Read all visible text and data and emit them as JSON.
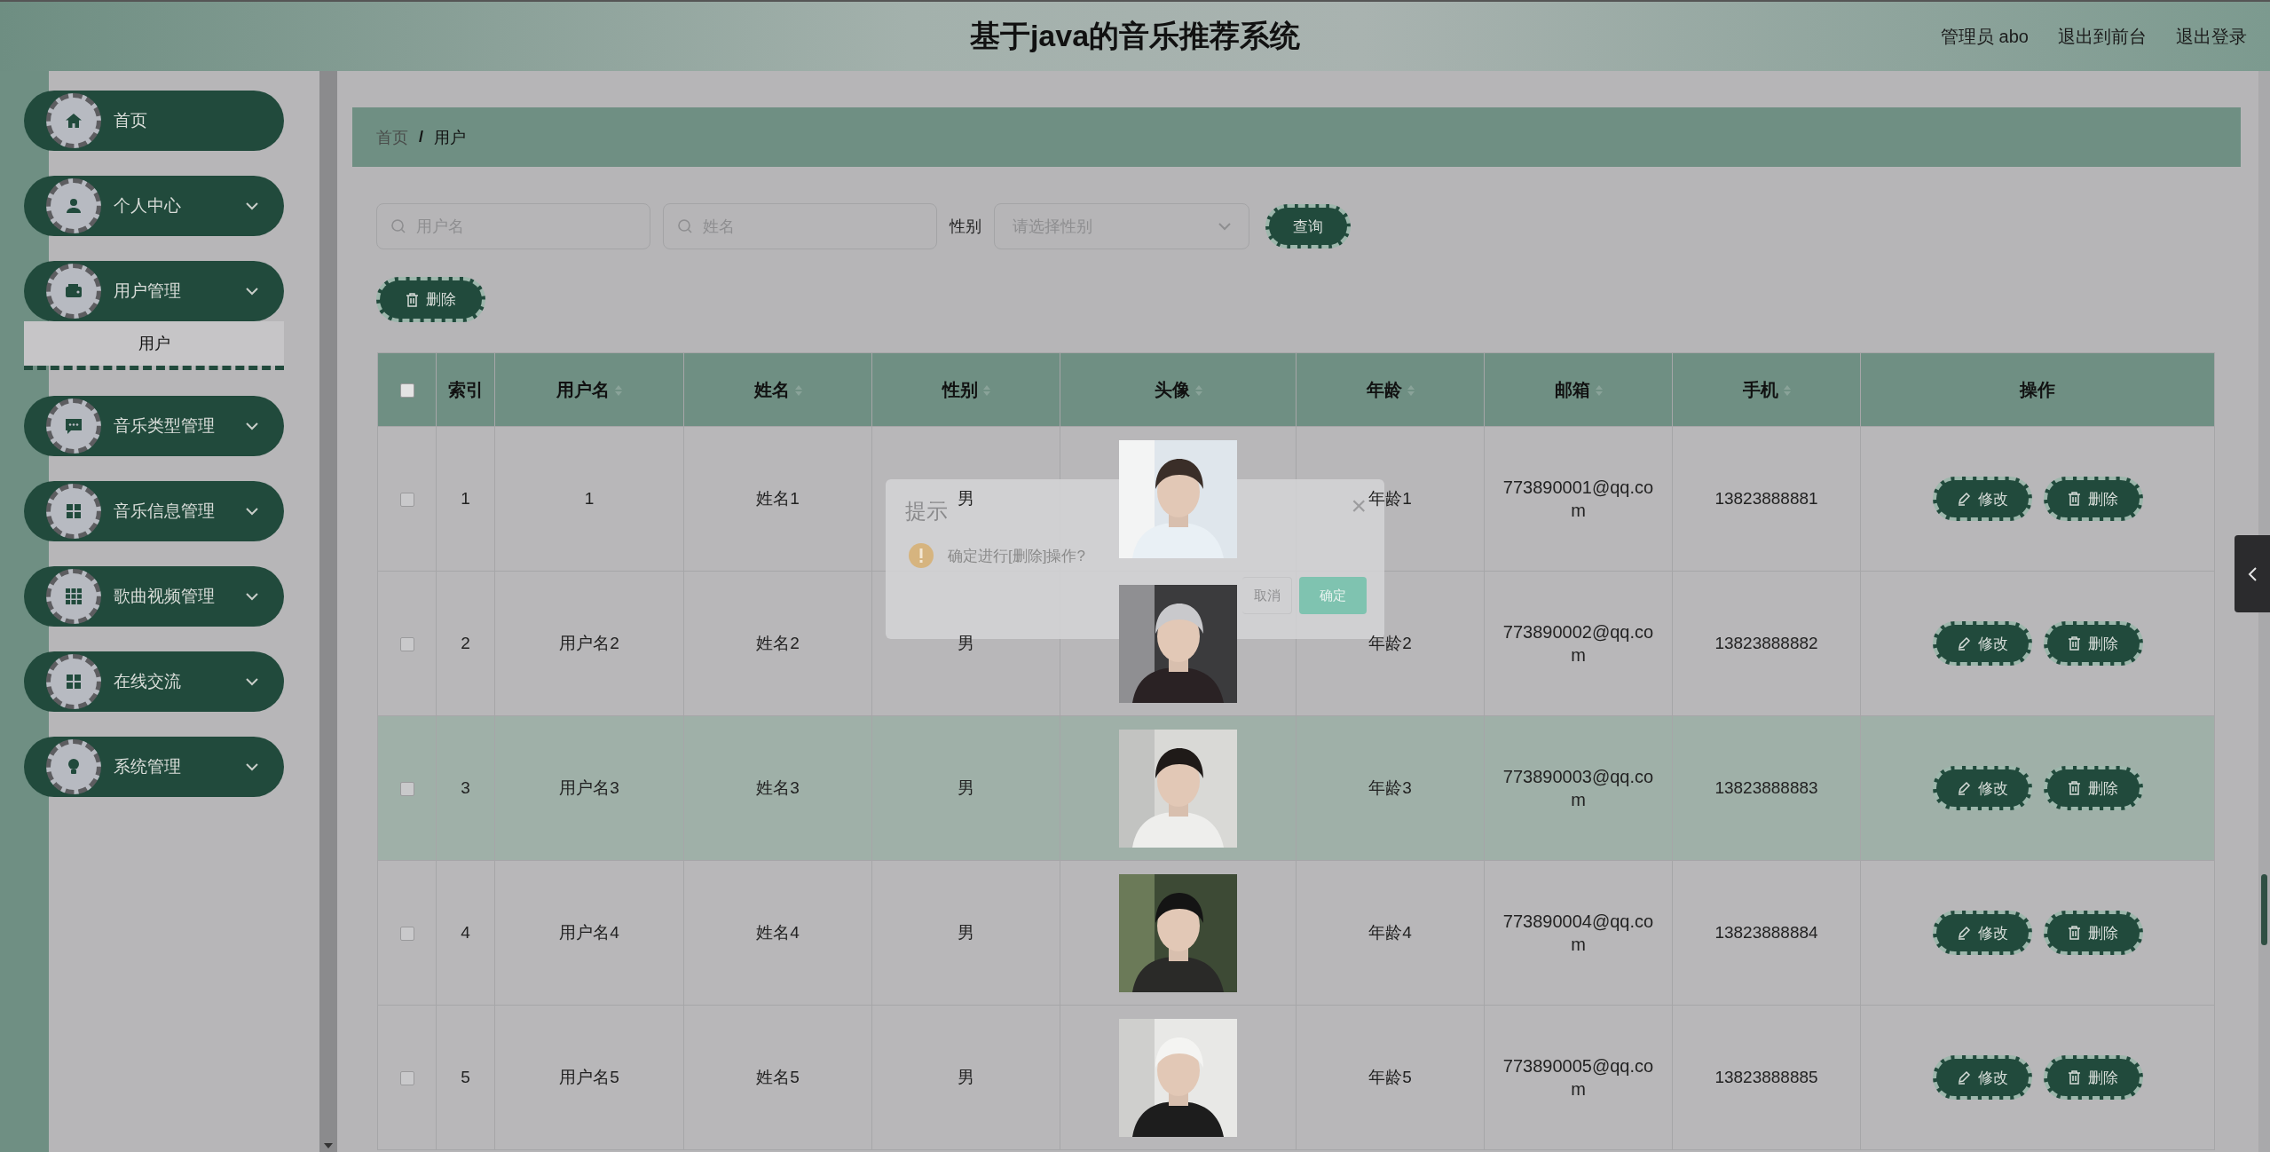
{
  "header": {
    "title": "基于java的音乐推荐系统",
    "links": [
      "管理员 abo",
      "退出到前台",
      "退出登录"
    ]
  },
  "sidebar": {
    "items": [
      {
        "label": "首页",
        "kind": "link"
      },
      {
        "label": "个人中心",
        "kind": "menu"
      },
      {
        "label": "用户管理",
        "kind": "menu",
        "children": [
          {
            "label": "用户",
            "selected": true
          }
        ]
      },
      {
        "label": "音乐类型管理",
        "kind": "menu"
      },
      {
        "label": "音乐信息管理",
        "kind": "menu"
      },
      {
        "label": "歌曲视频管理",
        "kind": "menu"
      },
      {
        "label": "在线交流",
        "kind": "menu"
      },
      {
        "label": "系统管理",
        "kind": "menu"
      }
    ]
  },
  "breadcrumb": {
    "items": [
      "首页",
      "用户"
    ],
    "separator": "/"
  },
  "search": {
    "fields": [
      {
        "placeholder": "用户名"
      },
      {
        "placeholder": "姓名"
      }
    ],
    "gender_label": "性别",
    "gender_select": {
      "placeholder": "请选择性别"
    },
    "query_button": "查询"
  },
  "toolbar": {
    "delete_button": "删除"
  },
  "table": {
    "select_all": {
      "checked": false
    },
    "columns": [
      {
        "label": "索引",
        "sortable": false
      },
      {
        "label": "用户名",
        "sortable": true
      },
      {
        "label": "姓名",
        "sortable": true
      },
      {
        "label": "性别",
        "sortable": true
      },
      {
        "label": "头像",
        "sortable": true
      },
      {
        "label": "年龄",
        "sortable": true
      },
      {
        "label": "邮箱",
        "sortable": true
      },
      {
        "label": "手机",
        "sortable": true
      },
      {
        "label": "操作",
        "sortable": false
      }
    ],
    "rows": [
      {
        "checked": false,
        "highlighted": false,
        "index": "1",
        "username": "1",
        "name": "姓名1",
        "gender": "男",
        "avatar": {
          "kind": "picture"
        },
        "age": "年龄1",
        "email": "773890001@qq.com",
        "phone": "13823888881",
        "actions": [
          {
            "label": "修改",
            "kind": "edit"
          },
          {
            "label": "删除",
            "kind": "delete"
          }
        ]
      },
      {
        "checked": false,
        "highlighted": false,
        "index": "2",
        "username": "用户名2",
        "name": "姓名2",
        "gender": "男",
        "avatar": {
          "kind": "picture"
        },
        "age": "年龄2",
        "email": "773890002@qq.com",
        "phone": "13823888882",
        "actions": [
          {
            "label": "修改",
            "kind": "edit"
          },
          {
            "label": "删除",
            "kind": "delete"
          }
        ]
      },
      {
        "checked": false,
        "highlighted": true,
        "index": "3",
        "username": "用户名3",
        "name": "姓名3",
        "gender": "男",
        "avatar": {
          "kind": "picture"
        },
        "age": "年龄3",
        "email": "773890003@qq.com",
        "phone": "13823888883",
        "actions": [
          {
            "label": "修改",
            "kind": "edit"
          },
          {
            "label": "删除",
            "kind": "delete"
          }
        ]
      },
      {
        "checked": false,
        "highlighted": false,
        "index": "4",
        "username": "用户名4",
        "name": "姓名4",
        "gender": "男",
        "avatar": {
          "kind": "picture"
        },
        "age": "年龄4",
        "email": "773890004@qq.com",
        "phone": "13823888884",
        "actions": [
          {
            "label": "修改",
            "kind": "edit"
          },
          {
            "label": "删除",
            "kind": "delete"
          }
        ]
      },
      {
        "checked": false,
        "highlighted": false,
        "index": "5",
        "username": "用户名5",
        "name": "姓名5",
        "gender": "男",
        "avatar": {
          "kind": "picture"
        },
        "age": "年龄5",
        "email": "773890005@qq.com",
        "phone": "13823888885",
        "actions": [
          {
            "label": "修改",
            "kind": "edit"
          },
          {
            "label": "删除",
            "kind": "delete"
          }
        ]
      }
    ]
  },
  "dialog": {
    "title": "提示",
    "close": "×",
    "message": "确定进行[删除]操作?",
    "buttons": [
      {
        "label": "取消",
        "kind": "secondary"
      },
      {
        "label": "确定",
        "kind": "primary"
      }
    ]
  }
}
